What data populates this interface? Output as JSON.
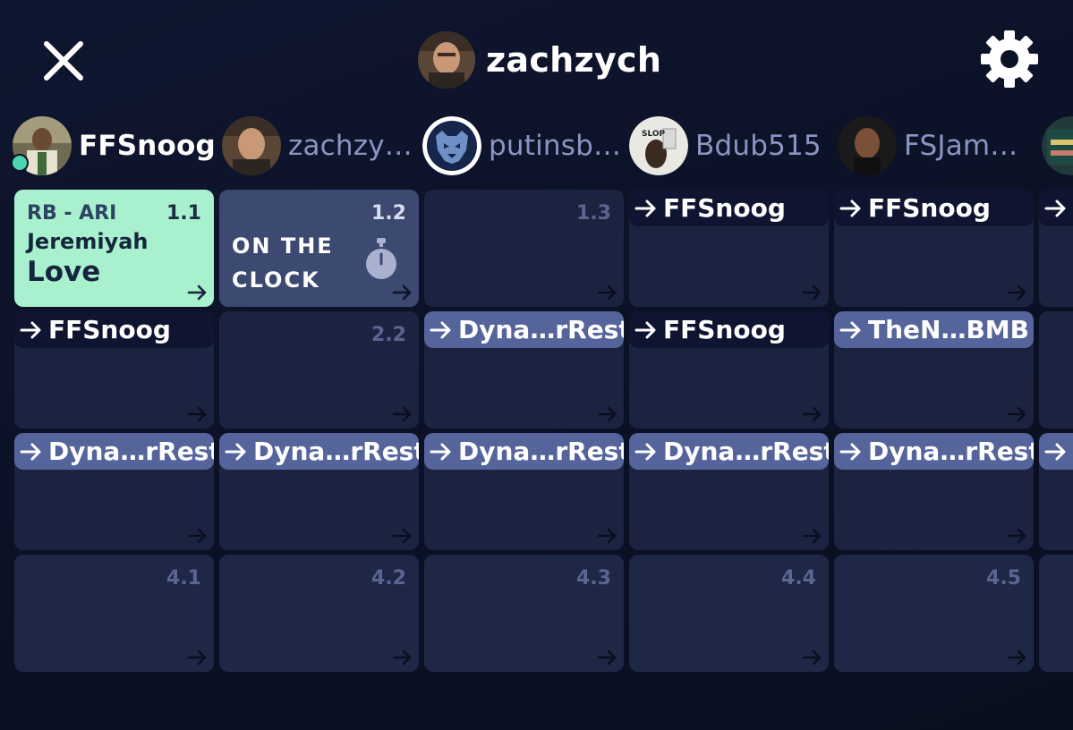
{
  "header": {
    "username": "zachzych",
    "close_icon": "close-icon",
    "settings_icon": "gear-icon"
  },
  "teams": [
    {
      "name": "FFSnoog",
      "active": true,
      "online": true
    },
    {
      "name": "zachzy…",
      "active": false
    },
    {
      "name": "putinsb…",
      "active": false
    },
    {
      "name": "Bdub515",
      "active": false
    },
    {
      "name": "FSJam…",
      "active": false
    }
  ],
  "board": {
    "row1": {
      "pick_1_1": {
        "number": "1.1",
        "position": "RB - ARI",
        "first_name": "Jeremiyah",
        "last_name": "Love"
      },
      "pick_1_2": {
        "number": "1.2",
        "status": "ON THE CLOCK"
      },
      "pick_1_3": {
        "number": "1.3"
      },
      "pick_1_4": {
        "traded_to": "FFSnoog"
      },
      "pick_1_5": {
        "traded_to": "FFSnoog"
      }
    },
    "row2": {
      "pick_2_1": {
        "traded_to": "FFSnoog"
      },
      "pick_2_2": {
        "number": "2.2"
      },
      "pick_2_3": {
        "traded_to": "Dyna…rRest"
      },
      "pick_2_4": {
        "traded_to": "FFSnoog"
      },
      "pick_2_5": {
        "traded_to": "TheN…BMB"
      }
    },
    "row3": {
      "pick_3_1": {
        "traded_to": "Dyna…rRest"
      },
      "pick_3_2": {
        "traded_to": "Dyna…rRest"
      },
      "pick_3_3": {
        "traded_to": "Dyna…rRest"
      },
      "pick_3_4": {
        "traded_to": "Dyna…rRest"
      },
      "pick_3_5": {
        "traded_to": "Dyna…rRest"
      }
    },
    "row4": {
      "pick_4_1": {
        "number": "4.1"
      },
      "pick_4_2": {
        "number": "4.2"
      },
      "pick_4_3": {
        "number": "4.3"
      },
      "pick_4_4": {
        "number": "4.4"
      },
      "pick_4_5": {
        "number": "4.5"
      }
    }
  },
  "colors": {
    "background": "#0c1226",
    "cell": "#1b2341",
    "picked_rb": "#a9f0cf",
    "on_the_clock": "#3c4970",
    "trade_badge_blue": "#56649c",
    "online": "#4cd6b0"
  }
}
